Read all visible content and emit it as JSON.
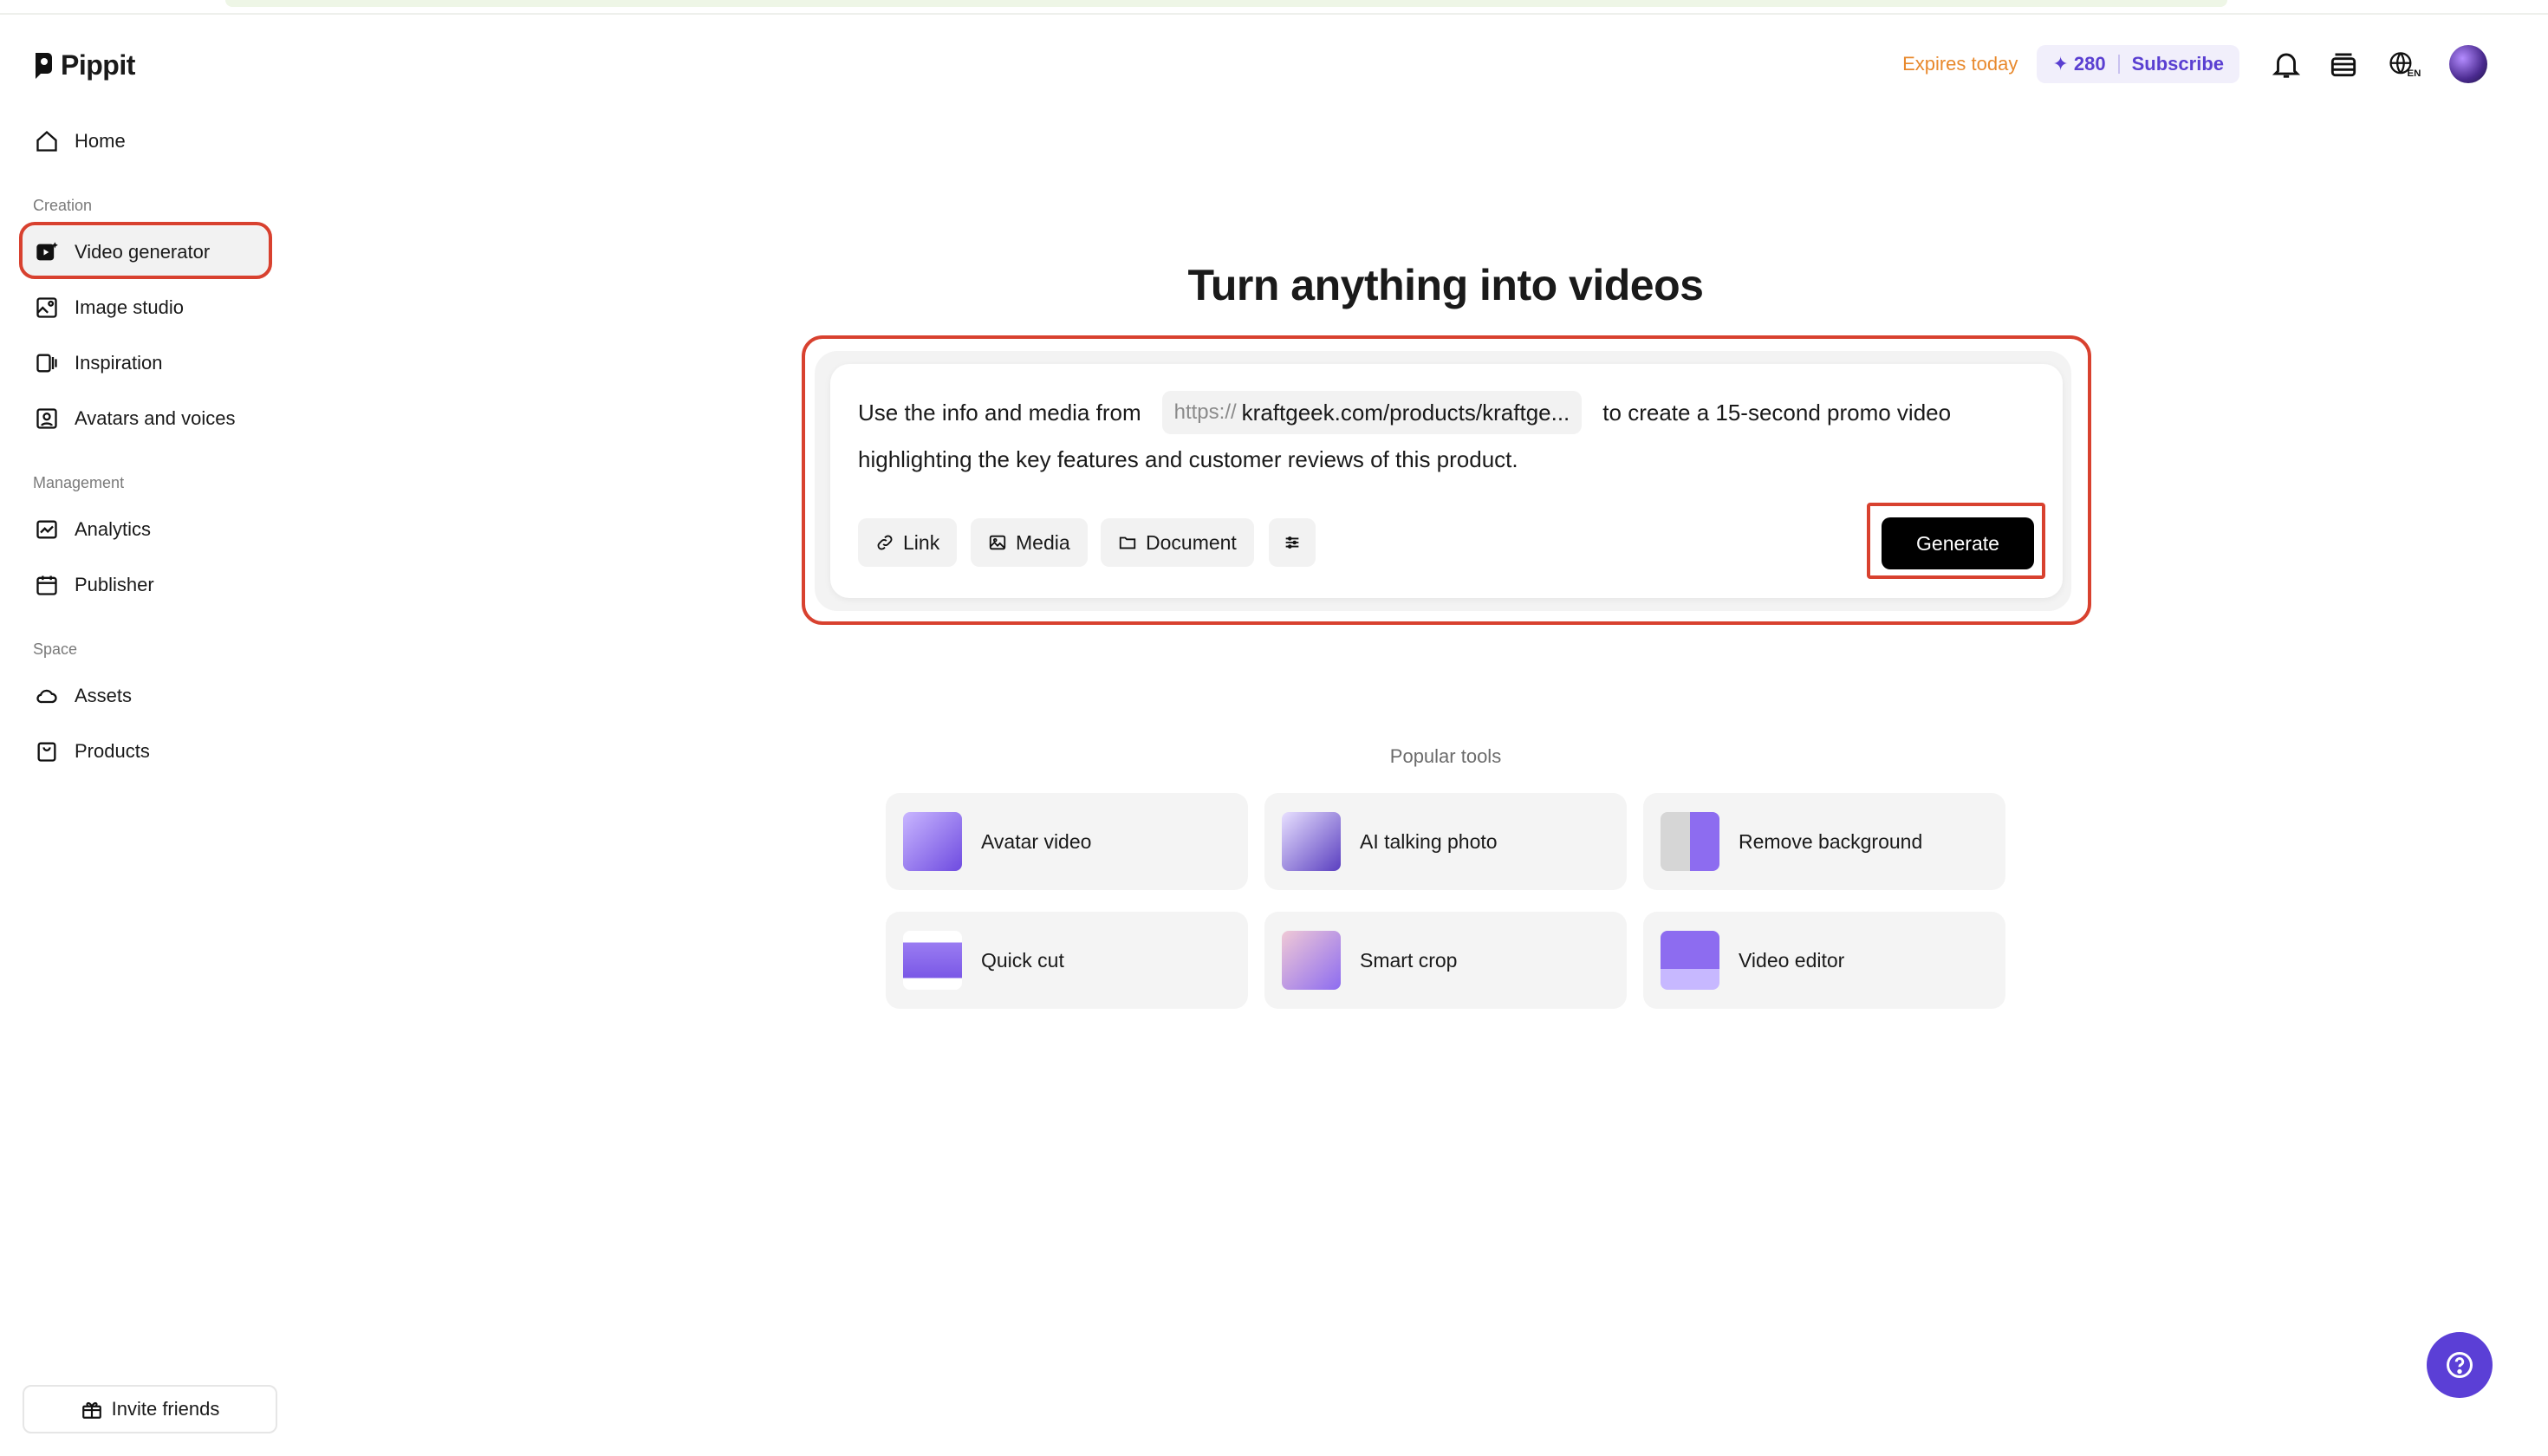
{
  "app": {
    "name": "Pippit"
  },
  "sidebar": {
    "home": "Home",
    "sections": {
      "creation": "Creation",
      "management": "Management",
      "space": "Space"
    },
    "items": {
      "video_generator": "Video generator",
      "image_studio": "Image studio",
      "inspiration": "Inspiration",
      "avatars_voices": "Avatars and voices",
      "analytics": "Analytics",
      "publisher": "Publisher",
      "assets": "Assets",
      "products": "Products"
    },
    "invite": "Invite friends"
  },
  "header": {
    "expires": "Expires today",
    "credits": "280",
    "subscribe": "Subscribe",
    "language": "EN"
  },
  "main": {
    "title": "Turn anything into videos",
    "prompt": {
      "before_url": "Use the info and media from",
      "url_protocol": "https://",
      "url_text": "kraftgeek.com/products/kraftge...",
      "after_url": "to create a 15-second promo video",
      "line2": "highlighting the key features and customer reviews of this product."
    },
    "buttons": {
      "link": "Link",
      "media": "Media",
      "document": "Document",
      "generate": "Generate"
    },
    "popular_label": "Popular tools",
    "tools": [
      "Avatar video",
      "AI talking photo",
      "Remove background",
      "Quick cut",
      "Smart crop",
      "Video editor"
    ]
  },
  "colors": {
    "accent": "#5b3fd6",
    "highlight": "#d8412f",
    "expires": "#e8892d"
  }
}
